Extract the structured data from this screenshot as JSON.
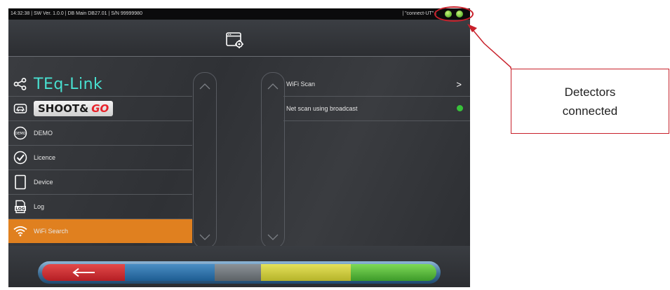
{
  "status_bar": {
    "left_text": "14:32:38  |  SW Ver. 1.0.0  |  DB Main DB27.01  |  S/N 99999980",
    "right_text": "|  \"connect-UT\"  |"
  },
  "header": {
    "icon": "settings-window-icon"
  },
  "menu": {
    "brand_teq": "TEq-Link",
    "brand_shoot": "SHOOT&",
    "brand_go": "GO",
    "items": [
      {
        "label": "DEMO",
        "icon": "demo-badge-icon"
      },
      {
        "label": "Licence",
        "icon": "shield-check-icon"
      },
      {
        "label": "Device",
        "icon": "tablet-icon"
      },
      {
        "label": "Log",
        "icon": "log-file-icon"
      },
      {
        "label": "WiFi Search",
        "icon": "wifi-icon",
        "active": true
      }
    ]
  },
  "settings": {
    "rows": [
      {
        "label": "WiFi Scan",
        "arrow": ">"
      },
      {
        "label": "Net scan using broadcast",
        "toggle_on": true
      }
    ]
  },
  "callout": {
    "line1": "Detectors",
    "line2": "connected"
  },
  "colors": {
    "active_menu": "#e0801f",
    "teq_link": "#48e0d0",
    "annotation_red": "#c8202a",
    "led_green": "#6fc23a"
  }
}
